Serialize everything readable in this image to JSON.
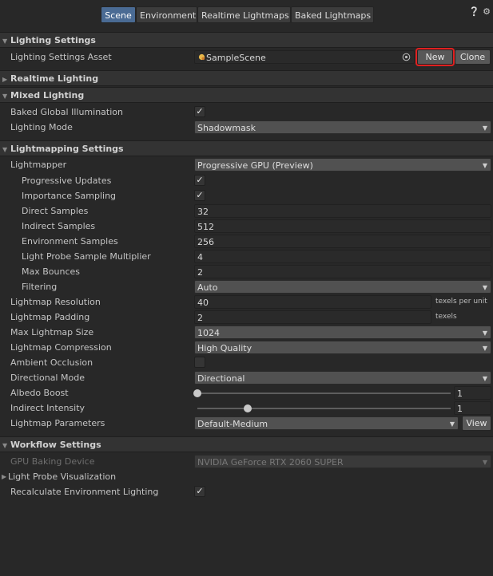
{
  "tabs": [
    {
      "label": "Scene",
      "active": true
    },
    {
      "label": "Environment",
      "active": false
    },
    {
      "label": "Realtime Lightmaps",
      "active": false
    },
    {
      "label": "Baked Lightmaps",
      "active": false
    }
  ],
  "icons": {
    "help": "help-icon",
    "settings": "gear-icon"
  },
  "lighting_settings": {
    "header": "Lighting Settings",
    "asset_label": "Lighting Settings Asset",
    "asset_value": "SampleScene",
    "new_button": "New",
    "clone_button": "Clone"
  },
  "realtime_lighting": {
    "header": "Realtime Lighting"
  },
  "mixed_lighting": {
    "header": "Mixed Lighting",
    "baked_gi_label": "Baked Global Illumination",
    "baked_gi_checked": true,
    "lighting_mode_label": "Lighting Mode",
    "lighting_mode_value": "Shadowmask"
  },
  "lightmapping": {
    "header": "Lightmapping Settings",
    "lightmapper_label": "Lightmapper",
    "lightmapper_value": "Progressive GPU (Preview)",
    "progressive_updates_label": "Progressive Updates",
    "importance_sampling_label": "Importance Sampling",
    "direct_samples_label": "Direct Samples",
    "direct_samples_value": "32",
    "indirect_samples_label": "Indirect Samples",
    "indirect_samples_value": "512",
    "environment_samples_label": "Environment Samples",
    "environment_samples_value": "256",
    "probe_multiplier_label": "Light Probe Sample Multiplier",
    "probe_multiplier_value": "4",
    "max_bounces_label": "Max Bounces",
    "max_bounces_value": "2",
    "filtering_label": "Filtering",
    "filtering_value": "Auto",
    "resolution_label": "Lightmap Resolution",
    "resolution_value": "40",
    "resolution_unit": "texels per unit",
    "padding_label": "Lightmap Padding",
    "padding_value": "2",
    "padding_unit": "texels",
    "max_size_label": "Max Lightmap Size",
    "max_size_value": "1024",
    "compression_label": "Lightmap Compression",
    "compression_value": "High Quality",
    "ambient_occlusion_label": "Ambient Occlusion",
    "directional_mode_label": "Directional Mode",
    "directional_mode_value": "Directional",
    "albedo_boost_label": "Albedo Boost",
    "albedo_boost_value": "1",
    "albedo_boost_level": 0.0,
    "indirect_intensity_label": "Indirect Intensity",
    "indirect_intensity_value": "1",
    "indirect_intensity_level": 0.2,
    "parameters_label": "Lightmap Parameters",
    "parameters_value": "Default-Medium",
    "view_button": "View"
  },
  "workflow": {
    "header": "Workflow Settings",
    "gpu_device_label": "GPU Baking Device",
    "gpu_device_value": "NVIDIA GeForce RTX 2060 SUPER",
    "probe_viz_label": "Light Probe Visualization",
    "recalc_label": "Recalculate Environment Lighting"
  },
  "colors": {
    "accent": "#4a6b94",
    "highlight": "#e02020",
    "background": "#282828"
  }
}
